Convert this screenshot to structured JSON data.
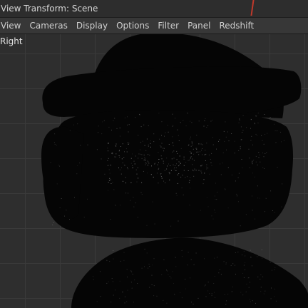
{
  "window": {
    "title": "View Transform: Scene"
  },
  "menu": {
    "items": [
      {
        "label": "View"
      },
      {
        "label": "Cameras"
      },
      {
        "label": "Display"
      },
      {
        "label": "Options"
      },
      {
        "label": "Filter"
      },
      {
        "label": "Panel"
      },
      {
        "label": "Redshift"
      }
    ]
  },
  "viewport": {
    "camera_label": "Right",
    "colors": {
      "background": "#2e2e2e",
      "grid": "#3a3a3a",
      "render": "#050505",
      "noise": "#e6e6e6"
    }
  }
}
